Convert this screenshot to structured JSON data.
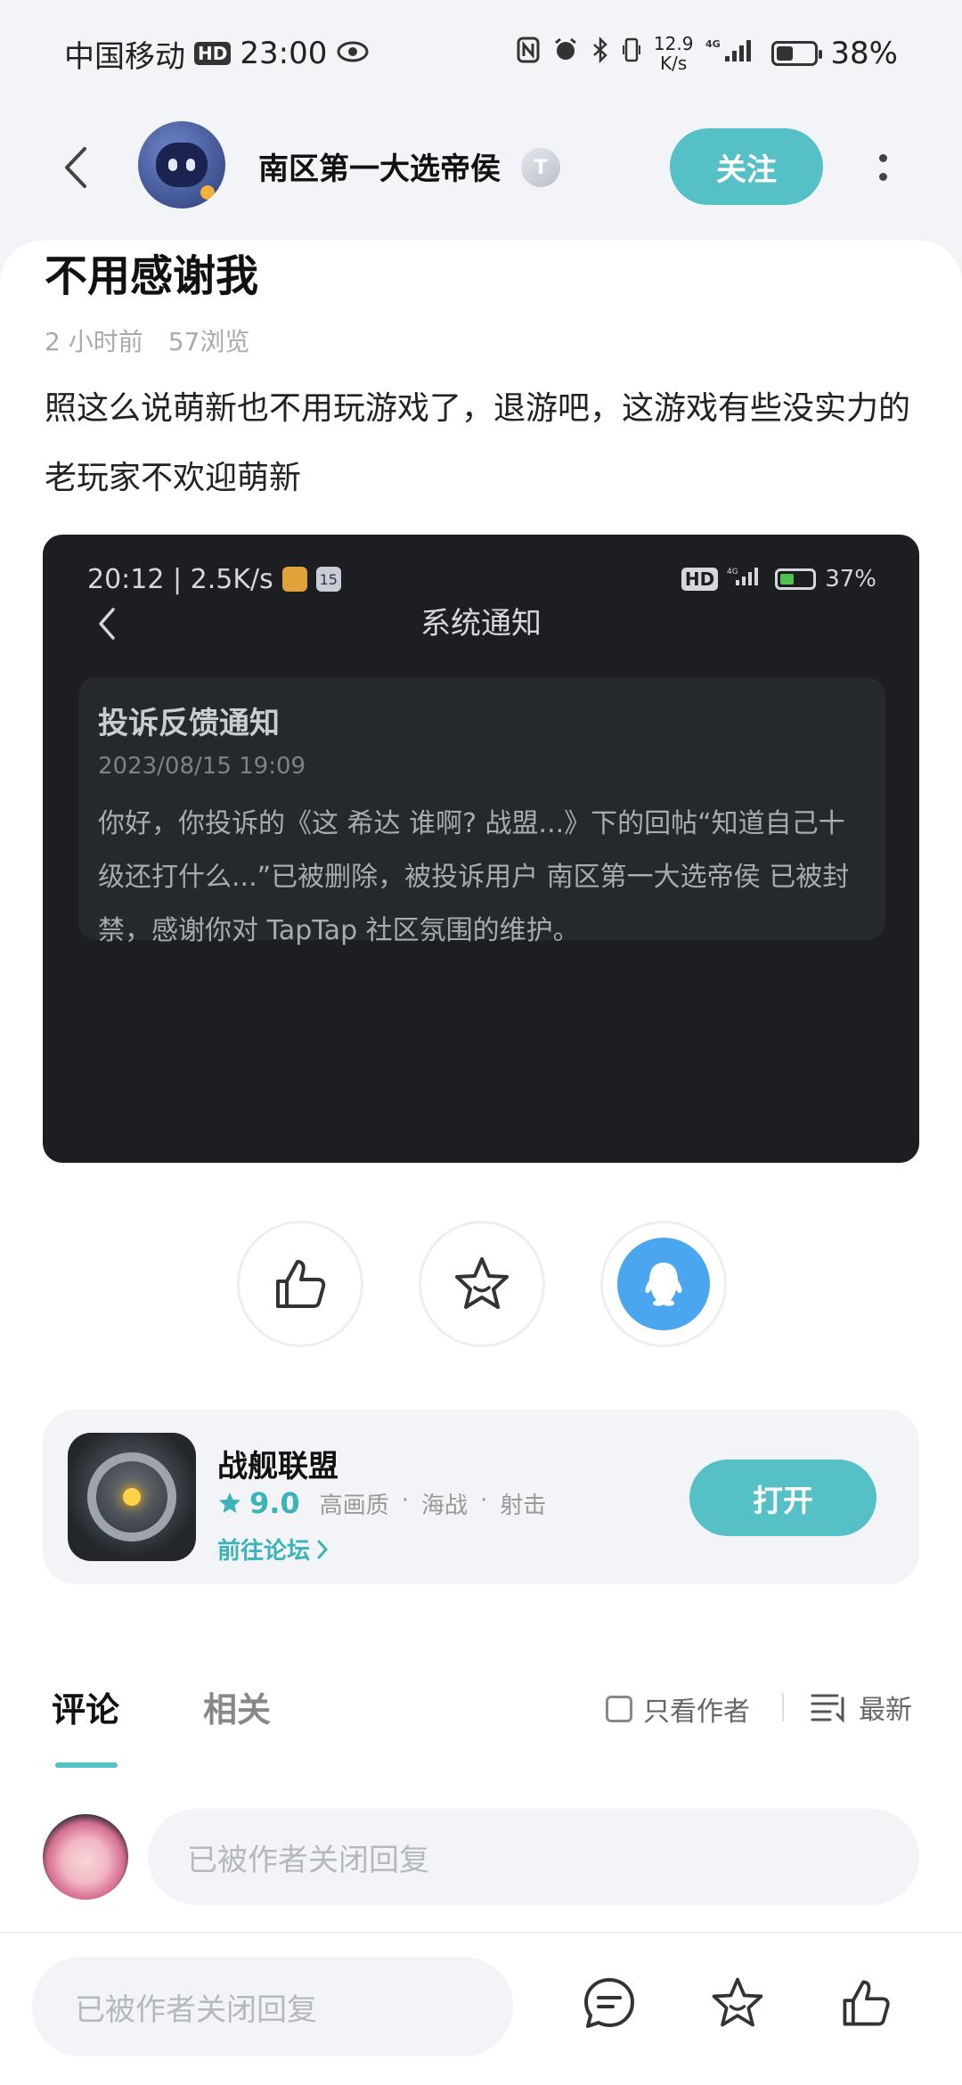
{
  "status_bar": {
    "carrier": "中国移动",
    "hd": "HD",
    "time": "23:00",
    "net_speed_value": "12.9",
    "net_speed_unit": "K/s",
    "network": "4G",
    "battery": "38%",
    "battery_level": 0.38
  },
  "header": {
    "author_name": "南区第一大选帝侯",
    "level_badge": "T",
    "follow_label": "关注"
  },
  "post": {
    "title": "不用感谢我",
    "time_ago": "2 小时前",
    "views": "57浏览",
    "body": "照这么说萌新也不用玩游戏了，退游吧，这游戏有些没实力的老玩家不欢迎萌新"
  },
  "embed": {
    "status_time": "20:12 | 2.5K/s",
    "calendar_day": "15",
    "hd": "HD",
    "network": "4G",
    "battery": "37%",
    "battery_level": 0.37,
    "nav_title": "系统通知",
    "notice_title": "投诉反馈通知",
    "notice_date": "2023/08/15 19:09",
    "notice_text": "你好，你投诉的《这 希达 谁啊? 战盟...》下的回帖“知道自己十级还打什么...”已被删除，被投诉用户 南区第一大选帝侯 已被封禁，感谢你对 TapTap 社区氛围的维护。"
  },
  "actions": [
    "like-icon",
    "star-icon",
    "qq-icon"
  ],
  "game": {
    "name": "战舰联盟",
    "score": "9.0",
    "tags": [
      "高画质",
      "·",
      "海战",
      "·",
      "射击"
    ],
    "forum_link": "前往论坛",
    "open_label": "打开"
  },
  "comments": {
    "tab_comments": "评论",
    "tab_related": "相关",
    "filter_author": "只看作者",
    "sort_label": "最新",
    "reply_placeholder": "已被作者关闭回复"
  },
  "bottom_bar": {
    "input_placeholder": "已被作者关闭回复",
    "icons": [
      "comment-icon",
      "star-icon",
      "like-icon"
    ]
  },
  "colors": {
    "accent": "#55c0c6",
    "accent_text": "#3bb3bb",
    "qq_blue": "#4aa6ef"
  }
}
